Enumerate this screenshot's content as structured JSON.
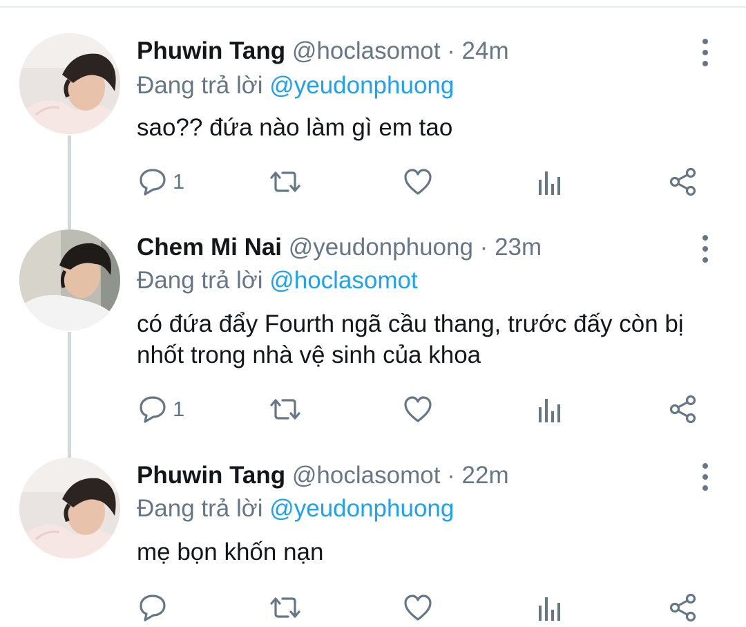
{
  "tweets": [
    {
      "name": "Phuwin Tang",
      "handle": "@hoclasomot",
      "separator": "·",
      "time": "24m",
      "reply_prefix": "Đang trả lời",
      "reply_to": "@yeudonphuong",
      "text": "sao?? đứa nào làm gì em tao",
      "reply_count": "1"
    },
    {
      "name": "Chem Mi Nai",
      "handle": "@yeudonphuong",
      "separator": "·",
      "time": "23m",
      "reply_prefix": "Đang trả lời",
      "reply_to": "@hoclasomot",
      "text": "có đứa đẩy Fourth ngã cầu thang, trước đấy còn bị nhốt trong nhà vệ sinh của khoa",
      "reply_count": "1"
    },
    {
      "name": "Phuwin Tang",
      "handle": "@hoclasomot",
      "separator": "·",
      "time": "22m",
      "reply_prefix": "Đang trả lời",
      "reply_to": "@yeudonphuong",
      "text": "mẹ bọn khốn nạn",
      "reply_count": ""
    }
  ],
  "icons": {
    "reply": "reply-icon",
    "retweet": "retweet-icon",
    "like": "heart-icon",
    "analytics": "analytics-icon",
    "share": "share-icon",
    "more": "more-vertical-icon"
  },
  "colors": {
    "text": "#14171a",
    "secondary": "#657786",
    "link": "#1da1f2",
    "thread_line": "#d3d8dc"
  }
}
